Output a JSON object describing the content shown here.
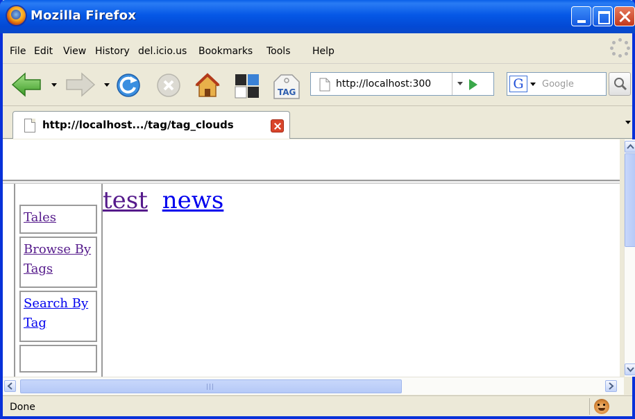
{
  "window": {
    "title": "Mozilla Firefox"
  },
  "menu": {
    "items": [
      "File",
      "Edit",
      "View",
      "History",
      "del.icio.us",
      "Bookmarks",
      "Tools",
      "Help"
    ]
  },
  "toolbar": {
    "url": "http://localhost:300",
    "search_engine_label": "G",
    "search_placeholder": "Google",
    "tag_label": "TAG"
  },
  "tab": {
    "title": "http://localhost.../tag/tag_clouds"
  },
  "sidebar": {
    "items": [
      "Tales",
      "Browse By Tags",
      "Search By Tag",
      ""
    ]
  },
  "tag_cloud": {
    "tags": [
      "test",
      "news"
    ]
  },
  "status": {
    "text": "Done"
  },
  "colors": {
    "visited_link": "#551a8b",
    "unvisited_link": "#0000ee",
    "title_bar": "#0558e6"
  }
}
